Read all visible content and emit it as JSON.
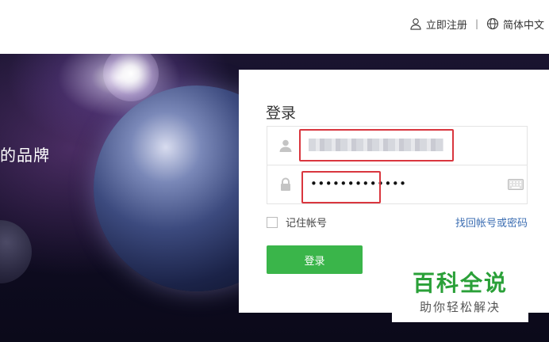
{
  "header": {
    "register_label": "立即注册",
    "separator": "|",
    "language_label": "简体中文"
  },
  "hero": {
    "slogan": "的品牌"
  },
  "login": {
    "title": "登录",
    "username_value": "",
    "password_value": "•••••••••••••",
    "remember_label": "记住帐号",
    "forgot_label": "找回帐号或密码",
    "submit_label": "登录"
  },
  "watermark": {
    "title": "百科全说",
    "subtitle": "助你轻松解决"
  },
  "colors": {
    "accent_green": "#3ab54a",
    "link_blue": "#3e6fb3",
    "highlight_red": "#d9363e",
    "watermark_green": "#2aa038"
  },
  "icons": {
    "register": "user-outline-icon",
    "language": "globe-icon",
    "username": "user-icon",
    "password": "lock-icon",
    "keyboard": "keyboard-icon"
  }
}
